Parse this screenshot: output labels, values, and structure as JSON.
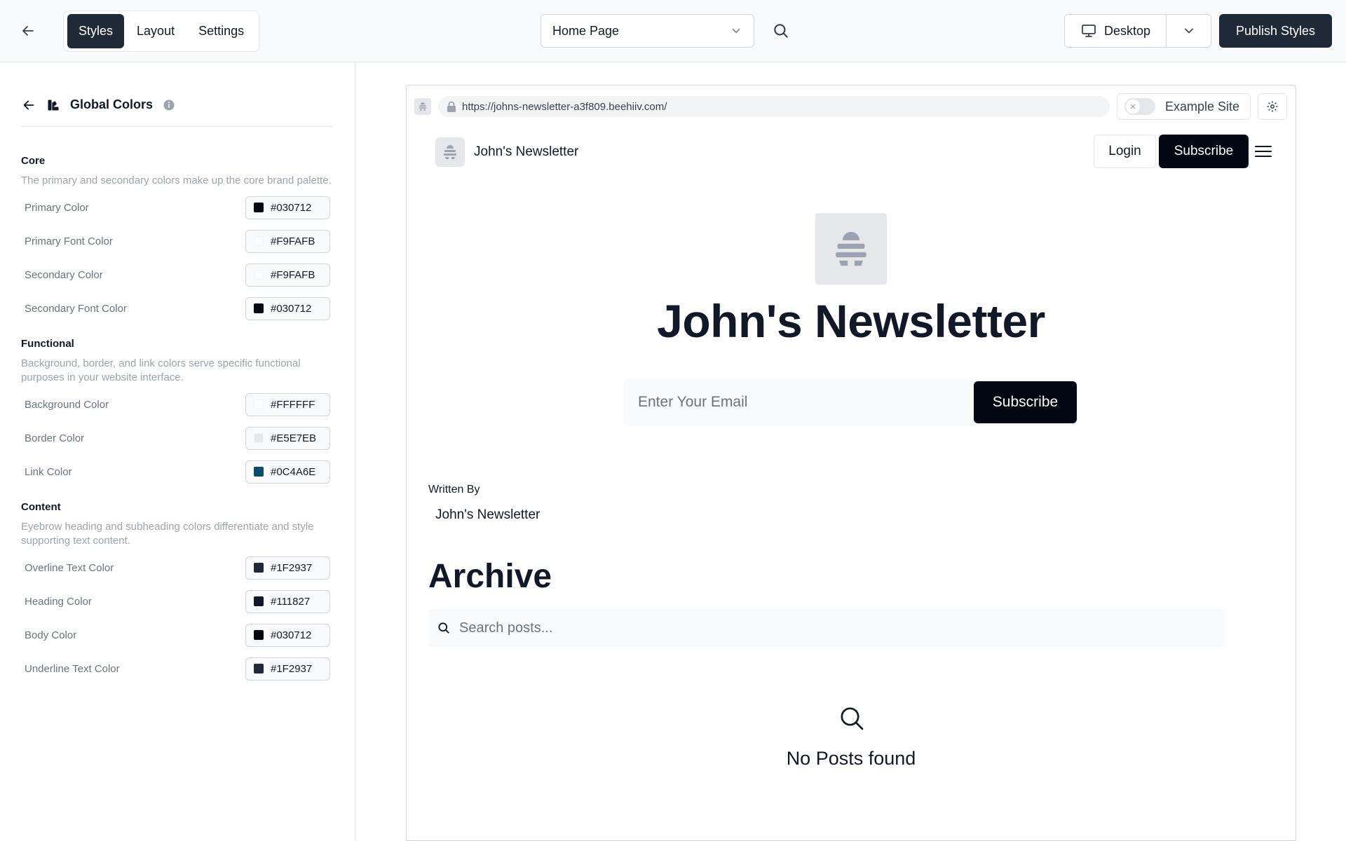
{
  "toolbar": {
    "tabs": [
      "Styles",
      "Layout",
      "Settings"
    ],
    "page_select": "Home Page",
    "device": "Desktop",
    "publish_label": "Publish Styles"
  },
  "sidebar": {
    "title": "Global Colors",
    "sections": [
      {
        "title": "Core",
        "description": "The primary and secondary colors make up the core brand palette.",
        "items": [
          {
            "label": "Primary Color",
            "value": "#030712",
            "color": "#030712"
          },
          {
            "label": "Primary Font Color",
            "value": "#F9FAFB",
            "color": "#F9FAFB"
          },
          {
            "label": "Secondary Color",
            "value": "#F9FAFB",
            "color": "#F9FAFB"
          },
          {
            "label": "Secondary Font Color",
            "value": "#030712",
            "color": "#030712"
          }
        ]
      },
      {
        "title": "Functional",
        "description": "Background, border, and link colors serve specific functional purposes in your website interface.",
        "items": [
          {
            "label": "Background Color",
            "value": "#FFFFFF",
            "color": "#FFFFFF"
          },
          {
            "label": "Border Color",
            "value": "#E5E7EB",
            "color": "#E5E7EB"
          },
          {
            "label": "Link Color",
            "value": "#0C4A6E",
            "color": "#0C4A6E"
          }
        ]
      },
      {
        "title": "Content",
        "description": "Eyebrow heading and subheading colors differentiate and style supporting text content.",
        "items": [
          {
            "label": "Overline Text Color",
            "value": "#1F2937",
            "color": "#1F2937"
          },
          {
            "label": "Heading Color",
            "value": "#111827",
            "color": "#111827"
          },
          {
            "label": "Body Color",
            "value": "#030712",
            "color": "#030712"
          },
          {
            "label": "Underline Text Color",
            "value": "#1F2937",
            "color": "#1F2937"
          }
        ]
      }
    ]
  },
  "preview": {
    "url": "https://johns-newsletter-a3f809.beehiiv.com/",
    "example_label": "Example Site",
    "site_name": "John's Newsletter",
    "login_label": "Login",
    "subscribe_label": "Subscribe",
    "hero_title": "John's Newsletter",
    "email_placeholder": "Enter Your Email",
    "email_submit": "Subscribe",
    "written_by_label": "Written By",
    "author_name": "John's Newsletter",
    "archive_title": "Archive",
    "search_placeholder": "Search posts...",
    "empty_text": "No Posts found"
  }
}
